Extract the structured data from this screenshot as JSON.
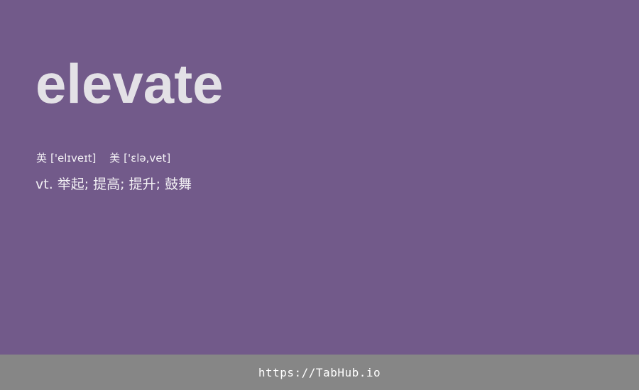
{
  "word": "elevate",
  "phonetics": {
    "uk": {
      "tag": "英",
      "ipa": "['elɪveɪt]"
    },
    "us": {
      "tag": "美",
      "ipa": "['ɛlə,vet]"
    }
  },
  "definition": {
    "pos": "vt.",
    "meanings": "举起; 提高; 提升; 鼓舞"
  },
  "footer": {
    "link_text": "https://TabHub.io"
  },
  "colors": {
    "background": "#725a8a",
    "word": "#e3e1e6",
    "footer_bg": "#868686",
    "text": "#f2f0f4"
  }
}
